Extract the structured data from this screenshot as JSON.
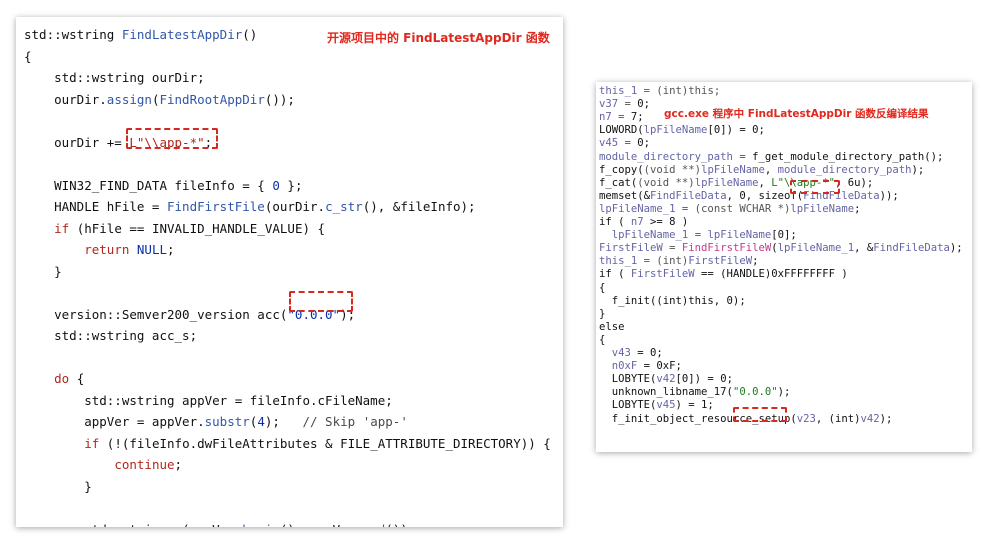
{
  "left": {
    "annotation": "开源项目中的 FindLatestAppDir 函数",
    "lines": [
      [
        {
          "t": "std::wstring ",
          "c": "p"
        },
        {
          "t": "FindLatestAppDir",
          "c": "f"
        },
        {
          "t": "()",
          "c": "p"
        }
      ],
      [
        {
          "t": "{",
          "c": "p"
        }
      ],
      [
        {
          "t": "    std::wstring ourDir;",
          "c": "p"
        }
      ],
      [
        {
          "t": "    ourDir.",
          "c": "p"
        },
        {
          "t": "assign",
          "c": "f"
        },
        {
          "t": "(",
          "c": "p"
        },
        {
          "t": "FindRootAppDir",
          "c": "f"
        },
        {
          "t": "());",
          "c": "p"
        }
      ],
      [],
      [
        {
          "t": "    ourDir += ",
          "c": "p"
        },
        {
          "t": "L\"\\\\app-*\"",
          "c": "k"
        },
        {
          "t": ";",
          "c": "p"
        }
      ],
      [],
      [
        {
          "t": "    WIN32_FIND_DATA fileInfo = { ",
          "c": "p"
        },
        {
          "t": "0",
          "c": "s"
        },
        {
          "t": " };",
          "c": "p"
        }
      ],
      [
        {
          "t": "    HANDLE hFile = ",
          "c": "p"
        },
        {
          "t": "FindFirstFile",
          "c": "f"
        },
        {
          "t": "(ourDir.",
          "c": "p"
        },
        {
          "t": "c_str",
          "c": "f"
        },
        {
          "t": "(), &fileInfo);",
          "c": "p"
        }
      ],
      [
        {
          "t": "    ",
          "c": "p"
        },
        {
          "t": "if",
          "c": "k"
        },
        {
          "t": " (hFile == INVALID_HANDLE_VALUE) {",
          "c": "p"
        }
      ],
      [
        {
          "t": "        ",
          "c": "p"
        },
        {
          "t": "return",
          "c": "k"
        },
        {
          "t": " ",
          "c": "p"
        },
        {
          "t": "NULL",
          "c": "s"
        },
        {
          "t": ";",
          "c": "p"
        }
      ],
      [
        {
          "t": "    }",
          "c": "p"
        }
      ],
      [],
      [
        {
          "t": "    version::Semver200_version acc(",
          "c": "p"
        },
        {
          "t": "\"0.0.0\"",
          "c": "s"
        },
        {
          "t": ");",
          "c": "p"
        }
      ],
      [
        {
          "t": "    std::wstring acc_s;",
          "c": "p"
        }
      ],
      [],
      [
        {
          "t": "    ",
          "c": "p"
        },
        {
          "t": "do",
          "c": "k"
        },
        {
          "t": " {",
          "c": "p"
        }
      ],
      [
        {
          "t": "        std::wstring appVer = fileInfo.cFileName;",
          "c": "p"
        }
      ],
      [
        {
          "t": "        appVer = appVer.",
          "c": "p"
        },
        {
          "t": "substr",
          "c": "f"
        },
        {
          "t": "(",
          "c": "p"
        },
        {
          "t": "4",
          "c": "s"
        },
        {
          "t": ");   ",
          "c": "p"
        },
        {
          "t": "// Skip 'app-'",
          "c": "c"
        }
      ],
      [
        {
          "t": "        ",
          "c": "p"
        },
        {
          "t": "if",
          "c": "k"
        },
        {
          "t": " (!(fileInfo.dwFileAttributes & FILE_ATTRIBUTE_DIRECTORY)) {",
          "c": "p"
        }
      ],
      [
        {
          "t": "            ",
          "c": "p"
        },
        {
          "t": "continue",
          "c": "k"
        },
        {
          "t": ";",
          "c": "p"
        }
      ],
      [
        {
          "t": "        }",
          "c": "p"
        }
      ],
      [],
      [
        {
          "t": "        std::string s(appVer.",
          "c": "p"
        },
        {
          "t": "begin",
          "c": "f"
        },
        {
          "t": "(), appVer.",
          "c": "p"
        },
        {
          "t": "end",
          "c": "f"
        },
        {
          "t": "());",
          "c": "p"
        }
      ]
    ]
  },
  "right": {
    "annotation": "gcc.exe 程序中 FindLatestAppDir 函数反编译结果",
    "lines": [
      [
        {
          "t": "this_1",
          "c": "gv"
        },
        {
          "t": " = (int)this;",
          "c": "gm"
        }
      ],
      [
        {
          "t": "v37",
          "c": "gv"
        },
        {
          "t": " = ",
          "c": "gm"
        },
        {
          "t": "0;",
          "c": "gb"
        }
      ],
      [
        {
          "t": "n7",
          "c": "gv"
        },
        {
          "t": " = ",
          "c": "gm"
        },
        {
          "t": "7;",
          "c": "gb"
        }
      ],
      [
        {
          "t": "LOWORD(",
          "c": "gb"
        },
        {
          "t": "lpFileName",
          "c": "gv"
        },
        {
          "t": "[0]) = 0;",
          "c": "gb"
        }
      ],
      [
        {
          "t": "v45",
          "c": "gv"
        },
        {
          "t": " = ",
          "c": "gm"
        },
        {
          "t": "0;",
          "c": "gb"
        }
      ],
      [
        {
          "t": "module_directory_path",
          "c": "gv"
        },
        {
          "t": " = ",
          "c": "gm"
        },
        {
          "t": "f_get_module_directory_path();",
          "c": "gb"
        }
      ],
      [
        {
          "t": "f_copy(",
          "c": "gb"
        },
        {
          "t": "(void **)",
          "c": "gm"
        },
        {
          "t": "lpFileName",
          "c": "gv"
        },
        {
          "t": ", ",
          "c": "gb"
        },
        {
          "t": "module_directory_path",
          "c": "gv"
        },
        {
          "t": ");",
          "c": "gb"
        }
      ],
      [
        {
          "t": "f_cat(",
          "c": "gb"
        },
        {
          "t": "(void **)",
          "c": "gm"
        },
        {
          "t": "lpFileName",
          "c": "gv"
        },
        {
          "t": ", ",
          "c": "gb"
        },
        {
          "t": "L\"\\\\app-*\"",
          "c": "gs"
        },
        {
          "t": ", 6u);",
          "c": "gb"
        }
      ],
      [
        {
          "t": "memset(&",
          "c": "gb"
        },
        {
          "t": "FindFileData",
          "c": "gv"
        },
        {
          "t": ", 0, sizeof(",
          "c": "gb"
        },
        {
          "t": "FindFileData",
          "c": "gv"
        },
        {
          "t": "));",
          "c": "gb"
        }
      ],
      [
        {
          "t": "lpFileName_1",
          "c": "gv"
        },
        {
          "t": " = (const WCHAR *)",
          "c": "gm"
        },
        {
          "t": "lpFileName",
          "c": "gv"
        },
        {
          "t": ";",
          "c": "gb"
        }
      ],
      [
        {
          "t": "if ( ",
          "c": "gb"
        },
        {
          "t": "n7",
          "c": "gv"
        },
        {
          "t": " >= 8 )",
          "c": "gb"
        }
      ],
      [
        {
          "t": "  ",
          "c": "gb"
        },
        {
          "t": "lpFileName_1",
          "c": "gv"
        },
        {
          "t": " = ",
          "c": "gm"
        },
        {
          "t": "lpFileName",
          "c": "gv"
        },
        {
          "t": "[0];",
          "c": "gb"
        }
      ],
      [
        {
          "t": "FirstFileW",
          "c": "gv"
        },
        {
          "t": " = ",
          "c": "gm"
        },
        {
          "t": "FindFirstFileW",
          "c": "gf"
        },
        {
          "t": "(",
          "c": "gb"
        },
        {
          "t": "lpFileName_1",
          "c": "gv"
        },
        {
          "t": ", &",
          "c": "gb"
        },
        {
          "t": "FindFileData",
          "c": "gv"
        },
        {
          "t": ");",
          "c": "gb"
        }
      ],
      [
        {
          "t": "this_1",
          "c": "gv"
        },
        {
          "t": " = (int)",
          "c": "gm"
        },
        {
          "t": "FirstFileW",
          "c": "gv"
        },
        {
          "t": ";",
          "c": "gb"
        }
      ],
      [
        {
          "t": "if ( ",
          "c": "gb"
        },
        {
          "t": "FirstFileW",
          "c": "gv"
        },
        {
          "t": " == (HANDLE)0xFFFFFFFF )",
          "c": "gb"
        }
      ],
      [
        {
          "t": "{",
          "c": "gb"
        }
      ],
      [
        {
          "t": "  f_init((int)this, 0);",
          "c": "gb"
        }
      ],
      [
        {
          "t": "}",
          "c": "gb"
        }
      ],
      [
        {
          "t": "else",
          "c": "gb"
        }
      ],
      [
        {
          "t": "{",
          "c": "gb"
        }
      ],
      [
        {
          "t": "  ",
          "c": "gb"
        },
        {
          "t": "v43",
          "c": "gv"
        },
        {
          "t": " = 0;",
          "c": "gb"
        }
      ],
      [
        {
          "t": "  ",
          "c": "gb"
        },
        {
          "t": "n0xF",
          "c": "gv"
        },
        {
          "t": " = 0xF;",
          "c": "gb"
        }
      ],
      [
        {
          "t": "  LOBYTE(",
          "c": "gb"
        },
        {
          "t": "v42",
          "c": "gv"
        },
        {
          "t": "[0]) = 0;",
          "c": "gb"
        }
      ],
      [
        {
          "t": "  unknown_libname_17(",
          "c": "gb"
        },
        {
          "t": "\"0.0.0\"",
          "c": "gs"
        },
        {
          "t": ");",
          "c": "gb"
        }
      ],
      [
        {
          "t": "  LOBYTE(",
          "c": "gb"
        },
        {
          "t": "v45",
          "c": "gv"
        },
        {
          "t": ") = 1;",
          "c": "gb"
        }
      ],
      [
        {
          "t": "  f_init_object_resource_setup(",
          "c": "gb"
        },
        {
          "t": "v23",
          "c": "gv"
        },
        {
          "t": ", (int)",
          "c": "gb"
        },
        {
          "t": "v42",
          "c": "gv"
        },
        {
          "t": ");",
          "c": "gb"
        }
      ]
    ]
  }
}
